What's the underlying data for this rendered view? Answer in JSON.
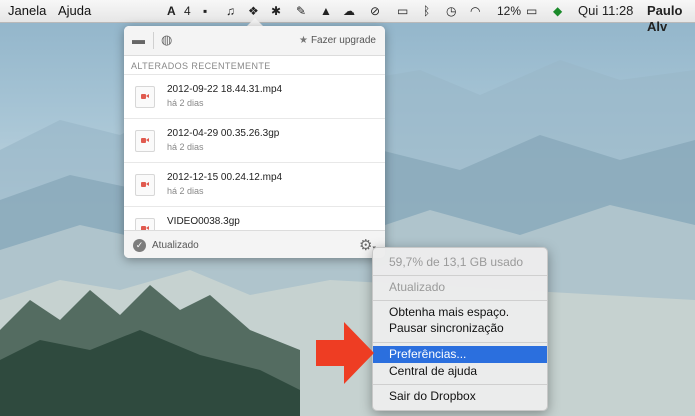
{
  "menubar": {
    "items": [
      "Janela",
      "Ajuda"
    ],
    "adobe_count": "4",
    "battery": "12%",
    "clock": "Qui 11:28",
    "user": "Paulo Alv"
  },
  "panel": {
    "upgrade_label": "Fazer upgrade",
    "section_title": "ALTERADOS RECENTEMENTE",
    "files": [
      {
        "name": "2012-09-22 18.44.31.mp4",
        "time": "há 2 dias"
      },
      {
        "name": "2012-04-29 00.35.26.3gp",
        "time": "há 2 dias"
      },
      {
        "name": "2012-12-15 00.24.12.mp4",
        "time": "há 2 dias"
      },
      {
        "name": "VIDEO0038.3gp",
        "time": ""
      }
    ],
    "status": "Atualizado"
  },
  "context_menu": {
    "usage": "59,7% de 13,1 GB usado",
    "updated": "Atualizado",
    "get_space": "Obtenha mais espaço.",
    "pause_sync": "Pausar sincronização",
    "preferences": "Preferências...",
    "help_center": "Central de ajuda",
    "quit": "Sair do Dropbox"
  },
  "colors": {
    "selection": "#2b6fde",
    "arrow": "#ee3d23",
    "video_icon": "#e05a4f"
  }
}
